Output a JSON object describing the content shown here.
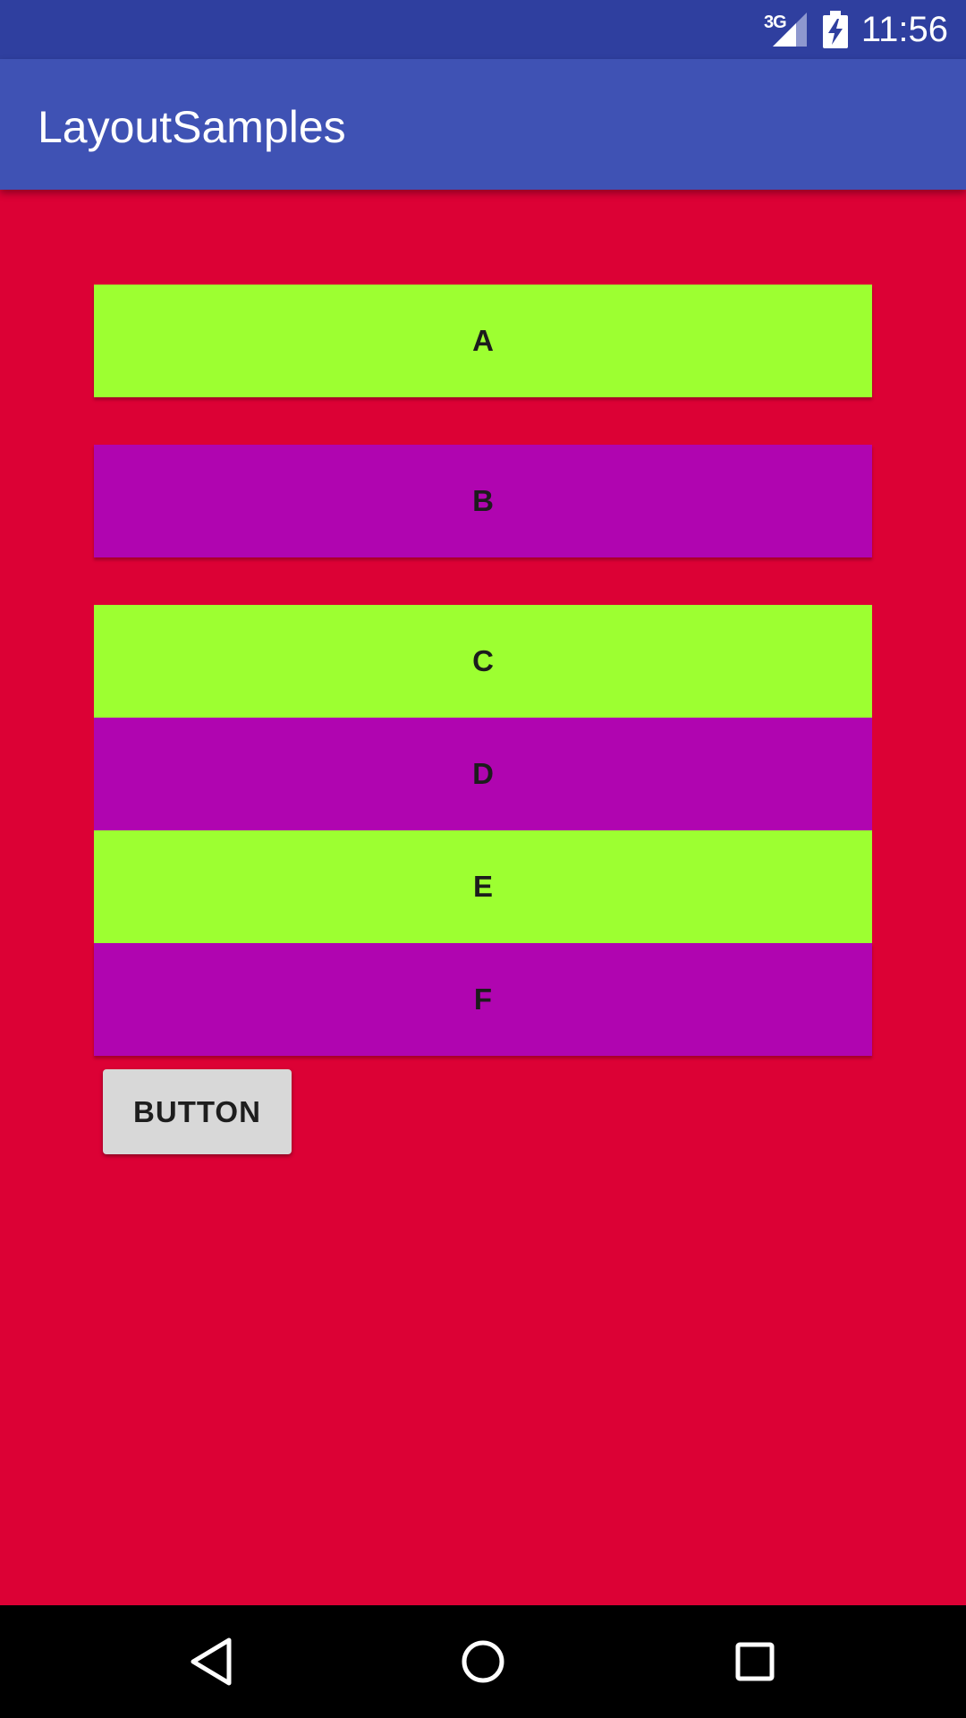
{
  "status_bar": {
    "network": "3G",
    "time": "11:56",
    "icons": [
      "signal-icon",
      "battery-charging-icon"
    ]
  },
  "app_bar": {
    "title": "LayoutSamples"
  },
  "blocks": [
    {
      "label": "A",
      "color": "#9dff31"
    },
    {
      "label": "B",
      "color": "#b005b0"
    },
    {
      "label": "C",
      "color": "#9dff31"
    },
    {
      "label": "D",
      "color": "#b005b0"
    },
    {
      "label": "E",
      "color": "#9dff31"
    },
    {
      "label": "F",
      "color": "#b005b0"
    }
  ],
  "button": {
    "label": "BUTTON"
  },
  "colors": {
    "background": "#dc0135",
    "status_bar": "#2f3f9f",
    "app_bar": "#3f52b4"
  },
  "nav_bar": {
    "icons": [
      "back-icon",
      "home-icon",
      "recents-icon"
    ]
  }
}
